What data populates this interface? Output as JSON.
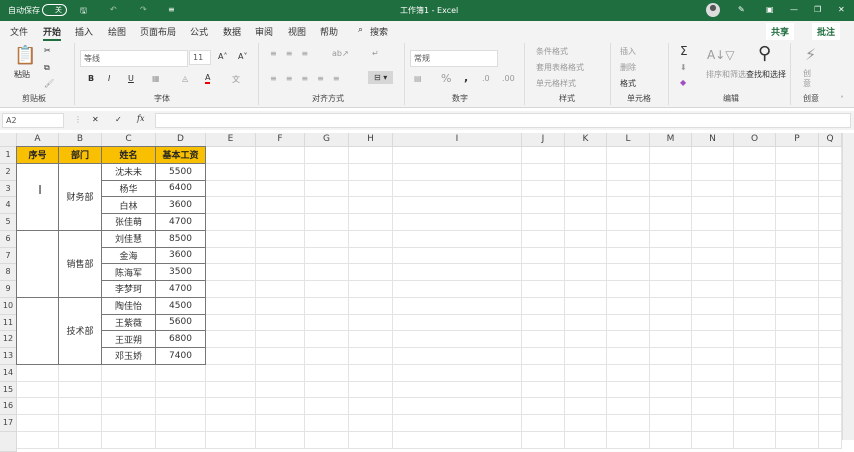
{
  "titlebar": {
    "autosave": "自动保存",
    "toggle": "关",
    "title": "工作簿1  -  Excel"
  },
  "tabs": [
    "文件",
    "开始",
    "插入",
    "绘图",
    "页面布局",
    "公式",
    "数据",
    "审阅",
    "视图",
    "帮助"
  ],
  "search": "搜索",
  "share": "共享",
  "comment": "批注",
  "ribbon": {
    "clipboard": {
      "paste": "粘贴",
      "label": "剪贴板"
    },
    "font": {
      "name": "等线",
      "size": "11",
      "bold": "B",
      "italic": "I",
      "underline": "U",
      "label": "字体"
    },
    "alignment": {
      "label": "对齐方式"
    },
    "number": {
      "format": "常规",
      "percent": "%",
      "comma": ",",
      "label": "数字"
    },
    "styles": {
      "cond": "条件格式",
      "table": "套用表格格式",
      "cell": "单元格样式",
      "label": "样式"
    },
    "cells": {
      "insert": "插入",
      "delete": "删除",
      "format": "格式",
      "label": "单元格"
    },
    "editing": {
      "sum": "Σ",
      "sort": "排序和筛选",
      "find": "查找和选择",
      "label": "编辑"
    },
    "ideas": {
      "btn": "创意",
      "label": "创意"
    }
  },
  "formula_bar": {
    "name_box": "A2",
    "fx": "fx",
    "value": ""
  },
  "columns": [
    "A",
    "B",
    "C",
    "D",
    "E",
    "F",
    "G",
    "H",
    "I",
    "J",
    "K",
    "L",
    "M",
    "N",
    "O",
    "P",
    "Q"
  ],
  "rows": [
    "1",
    "2",
    "3",
    "4",
    "5",
    "6",
    "7",
    "8",
    "9",
    "10",
    "11",
    "12",
    "13",
    "14",
    "15",
    "16",
    "17"
  ],
  "table": {
    "headers": [
      "序号",
      "部门",
      "姓名",
      "基本工资"
    ],
    "groups": [
      {
        "dept": "财务部",
        "people": [
          [
            "沈未未",
            "5500"
          ],
          [
            "杨华",
            "6400"
          ],
          [
            "白林",
            "3600"
          ],
          [
            "张佳萌",
            "4700"
          ]
        ]
      },
      {
        "dept": "销售部",
        "people": [
          [
            "刘佳慧",
            "8500"
          ],
          [
            "金海",
            "3600"
          ],
          [
            "陈海军",
            "3500"
          ],
          [
            "李梦珂",
            "4700"
          ]
        ]
      },
      {
        "dept": "技术部",
        "people": [
          [
            "陶佳怡",
            "4500"
          ],
          [
            "王紫薇",
            "5600"
          ],
          [
            "王亚朔",
            "6800"
          ],
          [
            "邓玉娇",
            "7400"
          ]
        ]
      }
    ]
  },
  "colors": {
    "titlebar": "#1f6e3f",
    "header_fill": "#f8c000"
  }
}
